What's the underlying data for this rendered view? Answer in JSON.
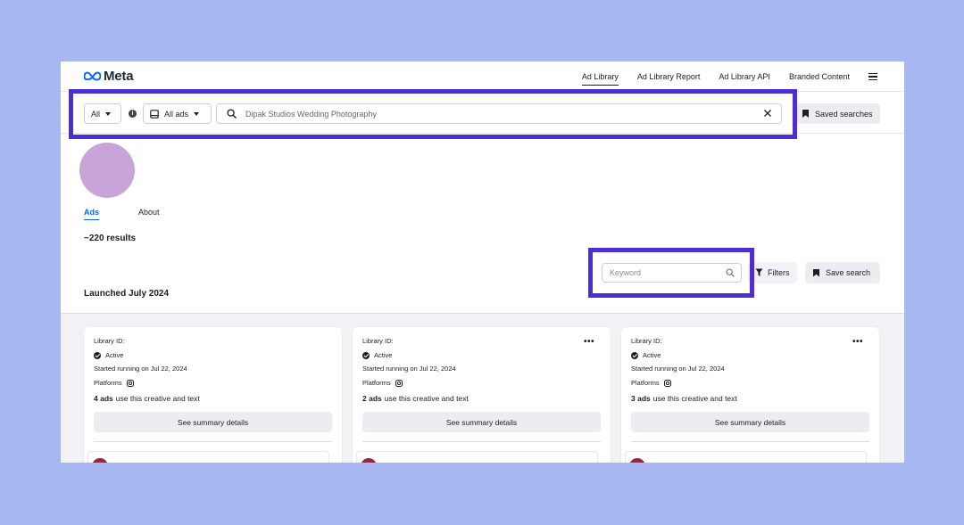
{
  "brand": {
    "name": "Meta"
  },
  "nav": {
    "links": [
      "Ad Library",
      "Ad Library Report",
      "Ad Library API",
      "Branded Content"
    ],
    "active": "Ad Library"
  },
  "search": {
    "country_value": "All",
    "ad_type_value": "All ads",
    "query": "Dipak Studios Wedding Photography",
    "saved_searches_label": "Saved searches"
  },
  "profile": {
    "tabs": [
      "Ads",
      "About"
    ],
    "active_tab": "Ads",
    "results": "~220 results"
  },
  "toolbar": {
    "keyword_placeholder": "Keyword",
    "filters_label": "Filters",
    "save_search_label": "Save search"
  },
  "section": {
    "launched": "Launched July 2024"
  },
  "cards": [
    {
      "library_id": "Library ID:",
      "status": "Active",
      "started": "Started running on Jul 22, 2024",
      "platforms": "Platforms",
      "ads_count": "4 ads",
      "ads_text": "use this creative and text",
      "summary": "See summary details"
    },
    {
      "library_id": "Library ID:",
      "status": "Active",
      "started": "Started running on Jul 22, 2024",
      "platforms": "Platforms",
      "ads_count": "2 ads",
      "ads_text": "use this creative and text",
      "summary": "See summary details"
    },
    {
      "library_id": "Library ID:",
      "status": "Active",
      "started": "Started running on Jul 22, 2024",
      "platforms": "Platforms",
      "ads_count": "3 ads",
      "ads_text": "use this creative and text",
      "summary": "See summary details"
    }
  ],
  "colors": {
    "background": "#a7b7f2",
    "highlight": "#4a2ed6",
    "accent": "#0866ff",
    "avatar": "#c9a4d8"
  }
}
